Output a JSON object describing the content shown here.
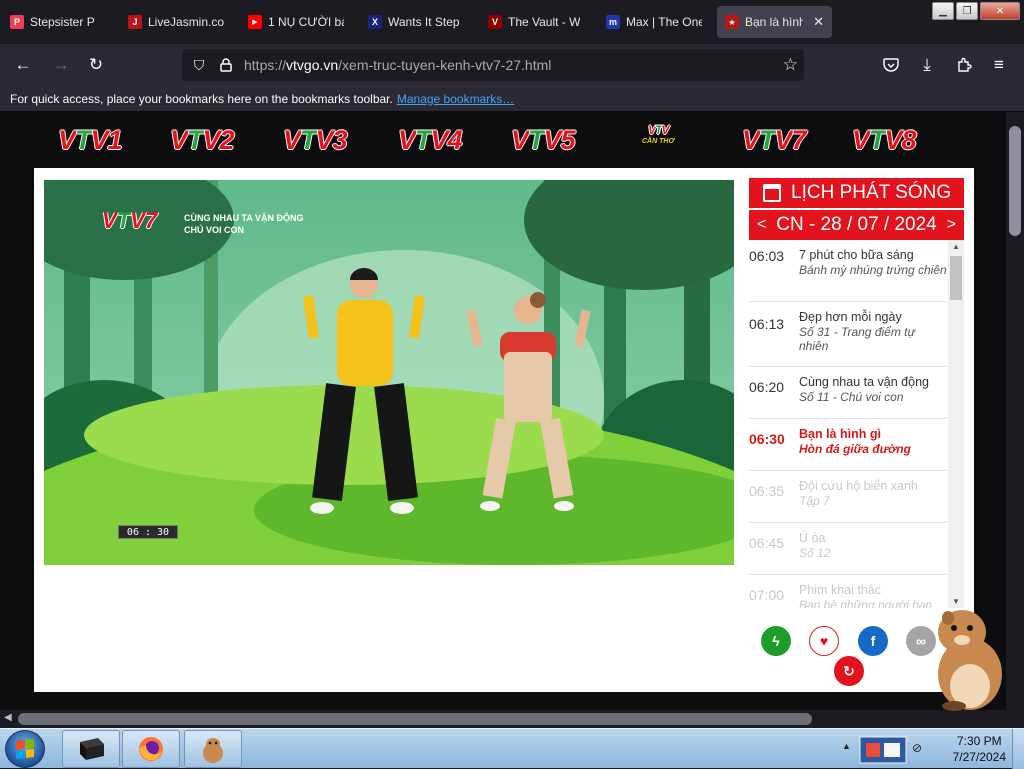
{
  "browser": {
    "tabs": [
      {
        "title": "Stepsister P",
        "icon": "pocket-icon",
        "color": "#ef3f56",
        "glyph": "P"
      },
      {
        "title": "LiveJasmin.co",
        "icon": "livejasmin-icon",
        "color": "#b8141c",
        "glyph": "J"
      },
      {
        "title": "1 NỤ CƯỜI bá",
        "icon": "youtube-icon",
        "color": "#ff0000",
        "glyph": "▶"
      },
      {
        "title": "Wants It Step",
        "icon": "x-icon",
        "color": "#1a237e",
        "glyph": "X"
      },
      {
        "title": "The Vault - W",
        "icon": "vault-icon",
        "color": "#8b0000",
        "glyph": "V"
      },
      {
        "title": "Max | The One",
        "icon": "m-icon",
        "color": "#1e3aa8",
        "glyph": "m"
      },
      {
        "title": "Bạn là hình",
        "icon": "vtv-icon",
        "color": "#b31b1b",
        "glyph": "★",
        "active": true
      }
    ],
    "url": {
      "scheme": "https://",
      "host": "vtvgo.vn",
      "path": "/xem-truc-tuyen-kenh-vtv7-27.html"
    },
    "bookmarks_hint": "For quick access, place your bookmarks here on the bookmarks toolbar.",
    "bookmarks_link": "Manage bookmarks…"
  },
  "channels": [
    {
      "label": "VTV1"
    },
    {
      "label": "VTV2"
    },
    {
      "label": "VTV3"
    },
    {
      "label": "VTV4"
    },
    {
      "label": "VTV5"
    },
    {
      "label": "VTV",
      "sub": "CẦN THƠ"
    },
    {
      "label": "VTV7"
    },
    {
      "label": "VTV8"
    }
  ],
  "video": {
    "channel_tag": "VTV7",
    "show_line1": "CÙNG NHAU TA VẬN ĐỘNG",
    "show_line2": "CHÚ VOI CON",
    "clock": "06 : 30"
  },
  "schedule": {
    "title": "LỊCH PHÁT SÓNG",
    "date": "CN - 28 / 07 / 2024",
    "prev": "<",
    "next": ">",
    "items": [
      {
        "time": "06:03",
        "name": "7 phút cho bữa sáng",
        "ep": "Bánh mỳ nhúng trứng chiên",
        "state": "past"
      },
      {
        "time": "06:13",
        "name": "Đẹp hơn mỗi ngày",
        "ep": "Số 31 - Trang điểm tự nhiên",
        "state": "past"
      },
      {
        "time": "06:20",
        "name": "Cùng nhau ta vận động",
        "ep": "Số 11 - Chú voi con",
        "state": "past"
      },
      {
        "time": "06:30",
        "name": "Bạn là hình gì",
        "ep": "Hòn đá giữa đường",
        "state": "now"
      },
      {
        "time": "06:35",
        "name": "Đội cứu hộ biển xanh",
        "ep": "Tập 7",
        "state": "future"
      },
      {
        "time": "06:45",
        "name": "Ú òa",
        "ep": "Số 12",
        "state": "future"
      },
      {
        "time": "07:00",
        "name": "Phim khai thác",
        "ep": "Bạn bè những người bạn",
        "state": "future"
      }
    ]
  },
  "actions": [
    {
      "name": "flash-button",
      "icon": "lightning-icon",
      "glyph": "ϟ",
      "bg": "#1f9d2b",
      "fg": "#ffffff"
    },
    {
      "name": "favorite-button",
      "icon": "heart-icon",
      "glyph": "♥",
      "bg": "#ffffff",
      "fg": "#e2131d"
    },
    {
      "name": "facebook-share-button",
      "icon": "facebook-icon",
      "glyph": "f",
      "bg": "#1769c6",
      "fg": "#ffffff"
    },
    {
      "name": "copy-link-button",
      "icon": "link-icon",
      "glyph": "∞",
      "bg": "#a5a5a5",
      "fg": "#ffffff"
    },
    {
      "name": "replay-button",
      "icon": "replay-icon",
      "glyph": "↻",
      "bg": "#e2131d",
      "fg": "#ffffff"
    }
  ],
  "taskbar": {
    "time": "7:30 PM",
    "date": "7/27/2024"
  }
}
